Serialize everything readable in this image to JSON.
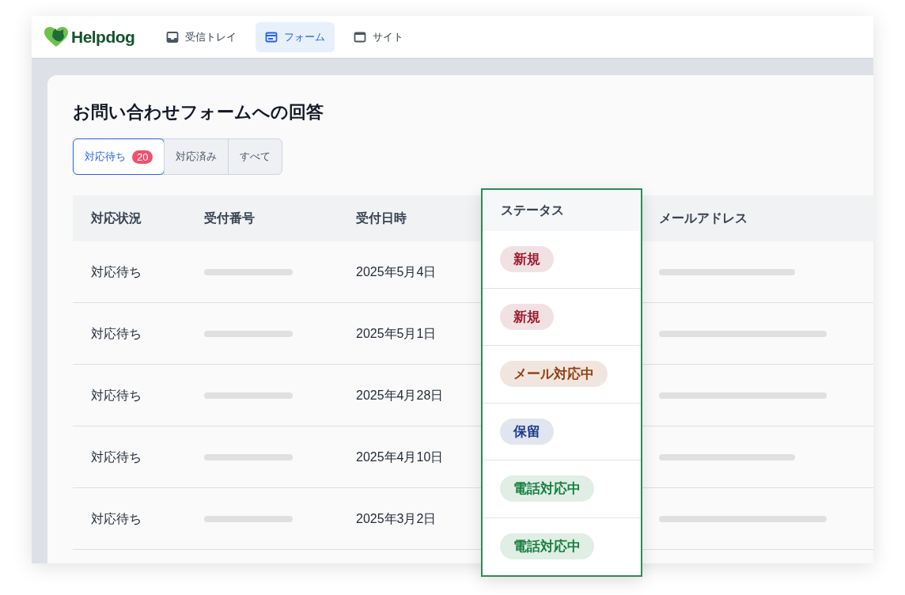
{
  "brand": "Helpdog",
  "nav": [
    {
      "label": "受信トレイ",
      "kind": "inbox",
      "selected": false
    },
    {
      "label": "フォーム",
      "kind": "form",
      "selected": true
    },
    {
      "label": "サイト",
      "kind": "site",
      "selected": false
    }
  ],
  "page_title": "お問い合わせフォームへの回答",
  "filter_tabs": [
    {
      "label": "対応待ち",
      "count": "20",
      "selected": true
    },
    {
      "label": "対応済み",
      "selected": false
    },
    {
      "label": "すべて",
      "selected": false
    }
  ],
  "table": {
    "columns": [
      "対応状況",
      "受付番号",
      "受付日時",
      "メールアドレス"
    ],
    "rows": [
      {
        "state": "対応待ち",
        "received": "2025年5月4日"
      },
      {
        "state": "対応待ち",
        "received": "2025年5月1日"
      },
      {
        "state": "対応待ち",
        "received": "2025年4月28日"
      },
      {
        "state": "対応待ち",
        "received": "2025年4月10日"
      },
      {
        "state": "対応待ち",
        "received": "2025年3月2日"
      }
    ]
  },
  "status_column": {
    "heading": "ステータス",
    "badges": [
      {
        "label": "新規",
        "color": "#9b1c2c"
      },
      {
        "label": "新規",
        "color": "#9b1c2c"
      },
      {
        "label": "メール対応中",
        "color": "#92400e"
      },
      {
        "label": "保留",
        "color": "#1e3a8a"
      },
      {
        "label": "電話対応中",
        "color": "#15803d"
      },
      {
        "label": "電話対応中",
        "color": "#15803d"
      }
    ]
  }
}
